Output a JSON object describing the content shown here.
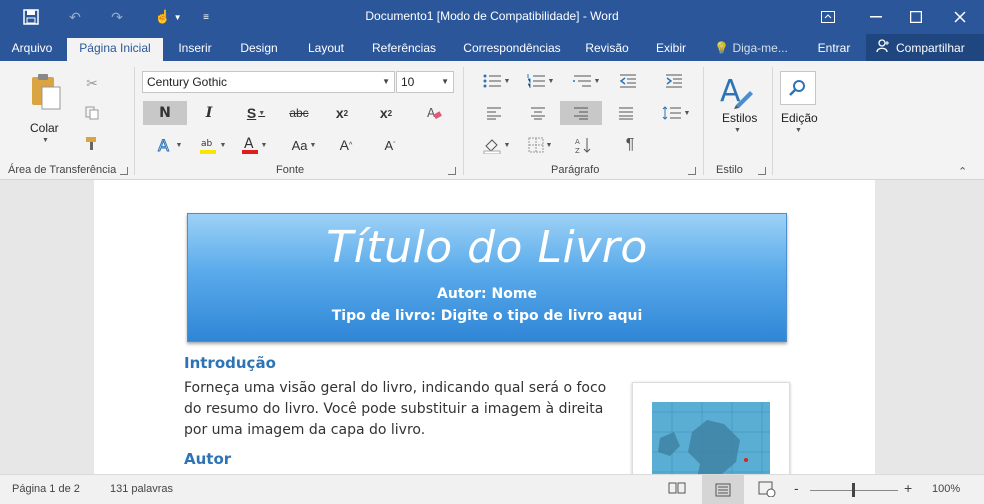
{
  "titlebar": {
    "title": "Documento1 [Modo de Compatibilidade] - Word",
    "icons": [
      "save-icon",
      "undo-icon",
      "redo-icon",
      "touch-mode-icon",
      "customize-qa-icon",
      "ribbon-display-icon",
      "minimize-icon",
      "maximize-icon",
      "close-icon"
    ]
  },
  "tabs": [
    {
      "label": "Arquivo"
    },
    {
      "label": "Página Inicial"
    },
    {
      "label": "Inserir"
    },
    {
      "label": "Design"
    },
    {
      "label": "Layout"
    },
    {
      "label": "Referências"
    },
    {
      "label": "Correspondências"
    },
    {
      "label": "Revisão"
    },
    {
      "label": "Exibir"
    },
    {
      "label": "Diga-me..."
    },
    {
      "label": "Entrar"
    }
  ],
  "share_label": "Compartilhar",
  "ribbon": {
    "clipboard": {
      "paste_label": "Colar",
      "group_label": "Área de Transferência"
    },
    "font": {
      "font_name": "Century Gothic",
      "font_size": "10",
      "bold": "N",
      "italic": "I",
      "underline": "S",
      "strike": "abc",
      "subscript": "x",
      "sub_mark": "2",
      "superscript": "x",
      "sup_mark": "2",
      "change_case": "Aa",
      "group_label": "Fonte"
    },
    "paragraph": {
      "pilcrow": "¶",
      "group_label": "Parágrafo"
    },
    "styles": {
      "label": "Estilos",
      "group_label": "Estilo"
    },
    "editing": {
      "label": "Edição"
    },
    "colors": {
      "highlight": "#f7e600",
      "font_color": "#e01d1d",
      "accent": "#2b579a"
    }
  },
  "document": {
    "title": "Título do Livro",
    "author_line": "Autor: Nome",
    "type_line": "Tipo de livro: Digite o tipo de livro aqui",
    "intro_heading": "Introdução",
    "intro_text": "Forneça uma visão geral do livro, indicando qual será o foco do resumo do livro. Você pode substituir a imagem à direita por uma imagem da capa do livro.",
    "author_heading": "Autor",
    "heading_color": "#2e74b5"
  },
  "status": {
    "page": "Página 1 de 2",
    "words": "131 palavras",
    "zoom": "100%",
    "zoom_minus": "-",
    "zoom_plus": "+"
  }
}
